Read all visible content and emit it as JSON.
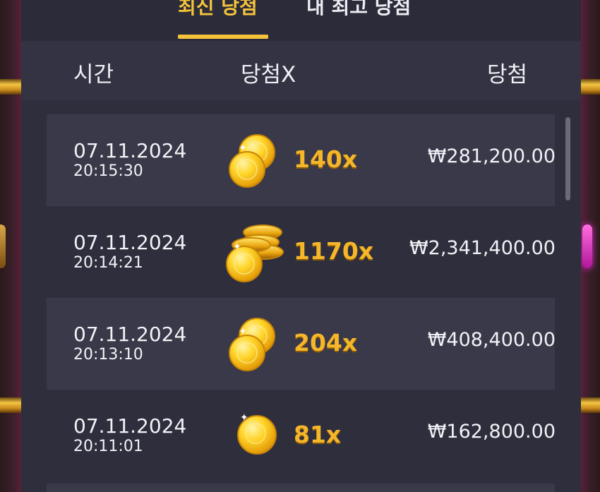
{
  "tabs": [
    {
      "label": "최신 당첨",
      "active": true
    },
    {
      "label": "내 최고 당첨",
      "active": false
    }
  ],
  "columns": {
    "time": "시간",
    "multiplier": "당첨X",
    "win": "당첨"
  },
  "rows": [
    {
      "date": "07.11.2024",
      "time": "20:15:30",
      "multiplier": "140x",
      "amount": "₩281,200.00",
      "icon": "coins-pair-icon"
    },
    {
      "date": "07.11.2024",
      "time": "20:14:21",
      "multiplier": "1170x",
      "amount": "₩2,341,400.00",
      "icon": "coin-stack-icon"
    },
    {
      "date": "07.11.2024",
      "time": "20:13:10",
      "multiplier": "204x",
      "amount": "₩408,400.00",
      "icon": "coins-pair-icon"
    },
    {
      "date": "07.11.2024",
      "time": "20:11:01",
      "multiplier": "81x",
      "amount": "₩162,800.00",
      "icon": "coin-icon"
    }
  ],
  "colors": {
    "accent": "#f5c33a",
    "multiplier": "#f5b62a",
    "panel": "#2e2e3d"
  }
}
